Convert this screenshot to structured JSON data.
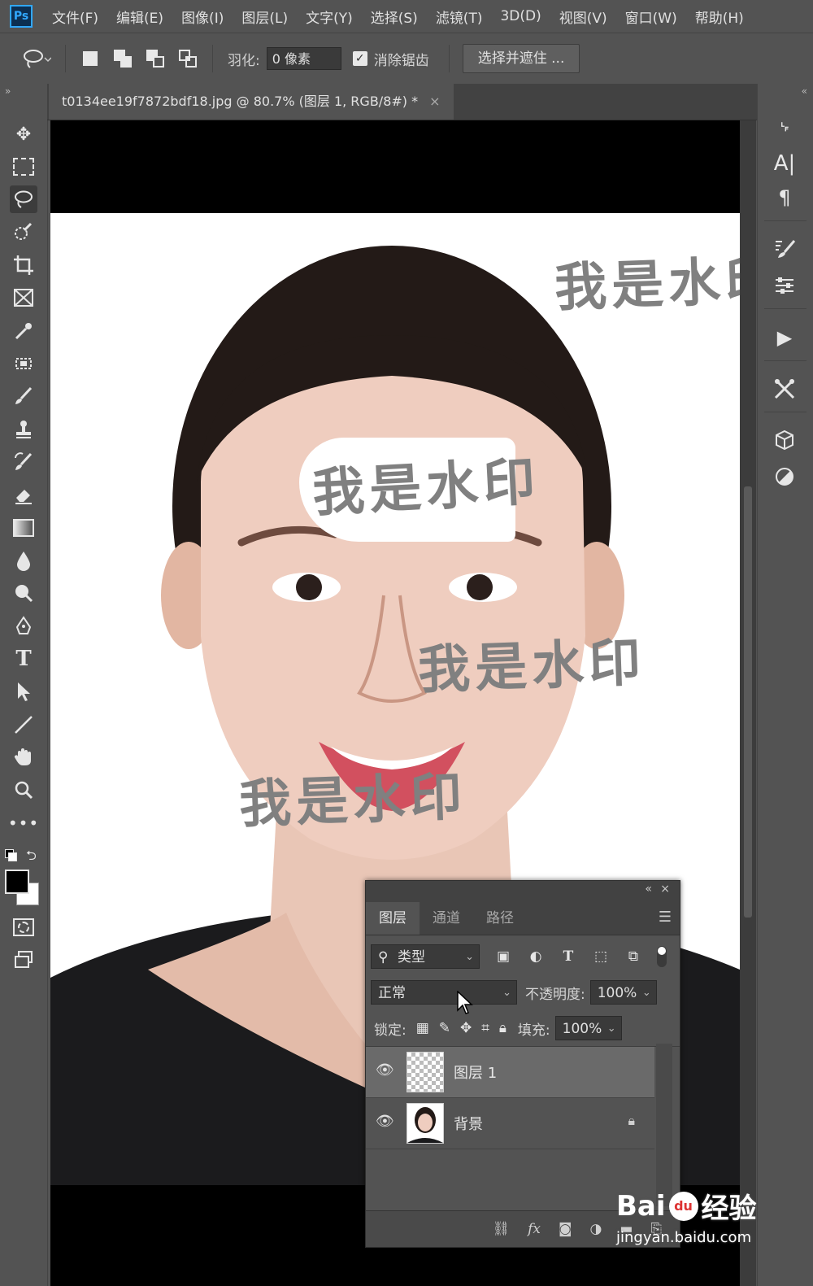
{
  "app": {
    "logo": "Ps"
  },
  "menu": [
    "文件(F)",
    "编辑(E)",
    "图像(I)",
    "图层(L)",
    "文字(Y)",
    "选择(S)",
    "滤镜(T)",
    "3D(D)",
    "视图(V)",
    "窗口(W)",
    "帮助(H)"
  ],
  "options": {
    "feather_label": "羽化:",
    "feather_value": "0 像素",
    "antialias_label": "消除锯齿",
    "antialias_checked": "✓",
    "select_mask_label": "选择并遮住 ..."
  },
  "document": {
    "tab_title": "t0134ee19f7872bdf18.jpg @ 80.7% (图层 1, RGB/8#) *",
    "close": "×"
  },
  "watermarks": [
    "我是水印",
    "我是水印",
    "我是水印",
    "我是水印"
  ],
  "layers_panel": {
    "collapse": "«",
    "close": "×",
    "tabs": [
      "图层",
      "通道",
      "路径"
    ],
    "filter_label": "类型",
    "blend_mode": "正常",
    "opacity_label": "不透明度:",
    "opacity_value": "100%",
    "lock_label": "锁定:",
    "fill_label": "填充:",
    "fill_value": "100%",
    "layers": [
      {
        "name": "图层 1",
        "selected": true
      },
      {
        "name": "背景",
        "selected": false
      }
    ]
  },
  "site_watermark": {
    "brand": "Bai",
    "brand2": "经验",
    "url": "jingyan.baidu.com"
  },
  "colors": {
    "ui_bg": "#535353",
    "panel_dark": "#424242",
    "selected_layer": "#6a6a6a",
    "accent": "#31a8ff"
  }
}
